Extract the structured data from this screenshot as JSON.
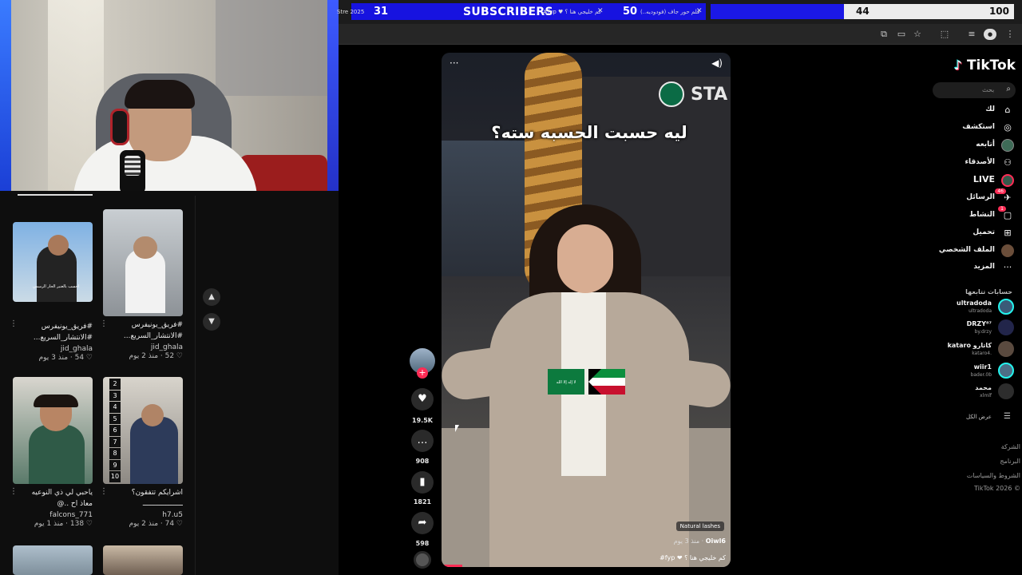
{
  "stream_overlay": {
    "subscriber_count": "31",
    "subscriber_label": "SUBSCRIBERS",
    "tab_snippet_1": "2025 Stre",
    "tab_snippet_2": "كم خليجي هنا ؟ ♥ fyp#",
    "tab_snippet_3": "فلم حور جاف (فودوديه..)",
    "tab_count_50": "50",
    "goal_current": "44",
    "goal_target": "100",
    "goal_fraction": 0.44
  },
  "left_grid": {
    "cards": [
      {
        "caption": "#فريق_يونيفرس",
        "caption2": "#الانتشار_السريع...",
        "user": "jid_ghala",
        "meta": "52 · منذ 2 يوم"
      },
      {
        "caption": "#فريق_يونيفرس",
        "caption2": "#الانتشار_السريع...",
        "user": "jid_ghala",
        "meta": "54 · منذ 3 يوم"
      },
      {
        "caption": "اشرايكم تتفقون؟",
        "caption2": "ـــــــــــــــــــ",
        "user": "h7.u5",
        "meta": "74 · منذ 2 يوم"
      },
      {
        "caption": "ياحبي لي ذي النوعيه",
        "caption2": "معاذ اح ..@",
        "user": "falcons_771",
        "meta": "138 · منذ 1 يوم"
      }
    ],
    "thumb_text_1": "احسب بالعنبر الحار الرسمي",
    "numbered_list": [
      "2",
      "3",
      "4",
      "5",
      "6",
      "7",
      "8",
      "9",
      "10"
    ]
  },
  "video": {
    "overlay_text": "ليه حسبت الحسبه سته؟",
    "sign_text": "STA",
    "flag_text": "لا إله إلا الله",
    "tag": "Natural lashes",
    "username": "Oiwl6",
    "time": "منذ 3 يوم",
    "caption": "كم خليجي هنا ؟ ❤ fyp#"
  },
  "actions": {
    "likes": "19.5K",
    "comments": "908",
    "saves": "1821",
    "shares": "598"
  },
  "sidebar": {
    "logo": "TikTok",
    "search_placeholder": "بحث",
    "nav": [
      {
        "label": "لك",
        "icon": "home-icon"
      },
      {
        "label": "استكشف",
        "icon": "compass-icon"
      },
      {
        "label": "أتابعه",
        "icon": "following-icon"
      },
      {
        "label": "الأصدقاء",
        "icon": "friends-icon"
      },
      {
        "label": "LIVE",
        "icon": "live-icon"
      },
      {
        "label": "الرسائل",
        "icon": "messages-icon",
        "badge": "46"
      },
      {
        "label": "النشاط",
        "icon": "activity-icon",
        "badge": "1"
      },
      {
        "label": "تحميل",
        "icon": "upload-icon"
      },
      {
        "label": "الملف الشخصي",
        "icon": "profile-icon"
      },
      {
        "label": "المزيد",
        "icon": "more-icon"
      }
    ],
    "following_title": "حسابات تتابعها",
    "following": [
      {
        "name": "ultradoda",
        "handle": "ultradoda"
      },
      {
        "name": "DRZY⁸⁷",
        "handle": "by.drzy"
      },
      {
        "name": "kataro كاتارو",
        "handle": "kataro4."
      },
      {
        "name": "wiir1",
        "handle": "bader.0b"
      },
      {
        "name": "محمد",
        "handle": "xlmlf"
      }
    ],
    "see_all": "عرض الكل",
    "footer": [
      "الشركة",
      "البرنامج",
      "الشروط والسياسات",
      "© TikTok 2026"
    ]
  }
}
